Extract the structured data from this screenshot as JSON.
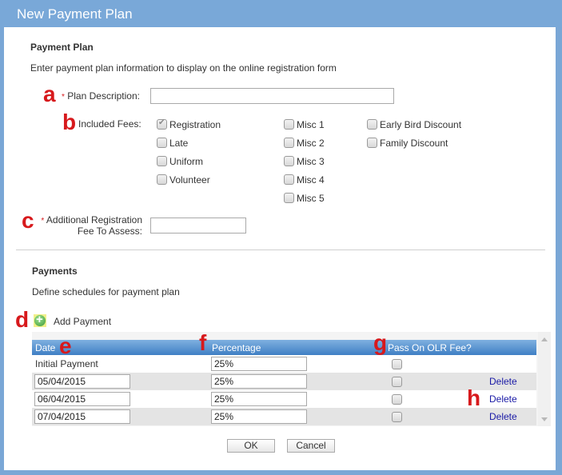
{
  "window": {
    "title": "New Payment Plan"
  },
  "payment_plan": {
    "section_title": "Payment Plan",
    "description": "Enter payment plan information to display on the online registration form",
    "plan_description": {
      "marker": "a",
      "required": "*",
      "label": "Plan Description:",
      "value": ""
    },
    "included_fees": {
      "marker": "b",
      "label": "Included Fees:",
      "options": [
        {
          "label": "Registration",
          "checked": true
        },
        {
          "label": "Late",
          "checked": false
        },
        {
          "label": "Uniform",
          "checked": false
        },
        {
          "label": "Volunteer",
          "checked": false
        },
        {
          "label": "Misc 1",
          "checked": false
        },
        {
          "label": "Misc 2",
          "checked": false
        },
        {
          "label": "Misc 3",
          "checked": false
        },
        {
          "label": "Misc 4",
          "checked": false
        },
        {
          "label": "Misc 5",
          "checked": false
        },
        {
          "label": "Early Bird Discount",
          "checked": false
        },
        {
          "label": "Family Discount",
          "checked": false
        }
      ]
    },
    "additional_fee": {
      "marker": "c",
      "required": "*",
      "label_line1": "Additional Registration",
      "label_line2": "Fee To Assess:",
      "value": ""
    }
  },
  "payments": {
    "section_title": "Payments",
    "description": "Define schedules for payment plan",
    "add_marker": "d",
    "add_label": "Add Payment",
    "icon": "add-circle-icon",
    "columns": [
      {
        "label": "Date",
        "marker": "e"
      },
      {
        "label": "Percentage",
        "marker": "f"
      },
      {
        "label": "Pass On OLR Fee?",
        "marker": "g"
      }
    ],
    "delete_marker": "h",
    "rows": [
      {
        "date": "Initial Payment",
        "date_editable": false,
        "percentage": "25%",
        "pass_on": false,
        "delete": ""
      },
      {
        "date": "05/04/2015",
        "date_editable": true,
        "percentage": "25%",
        "pass_on": false,
        "delete": "Delete"
      },
      {
        "date": "06/04/2015",
        "date_editable": true,
        "percentage": "25%",
        "pass_on": false,
        "delete": "Delete"
      },
      {
        "date": "07/04/2015",
        "date_editable": true,
        "percentage": "25%",
        "pass_on": false,
        "delete": "Delete"
      }
    ]
  },
  "buttons": {
    "ok": "OK",
    "cancel": "Cancel"
  },
  "colors": {
    "titlebar": "#79a8d8",
    "marker": "#d7191c",
    "header": "#3f7fc4",
    "link": "#1a1aa6"
  }
}
